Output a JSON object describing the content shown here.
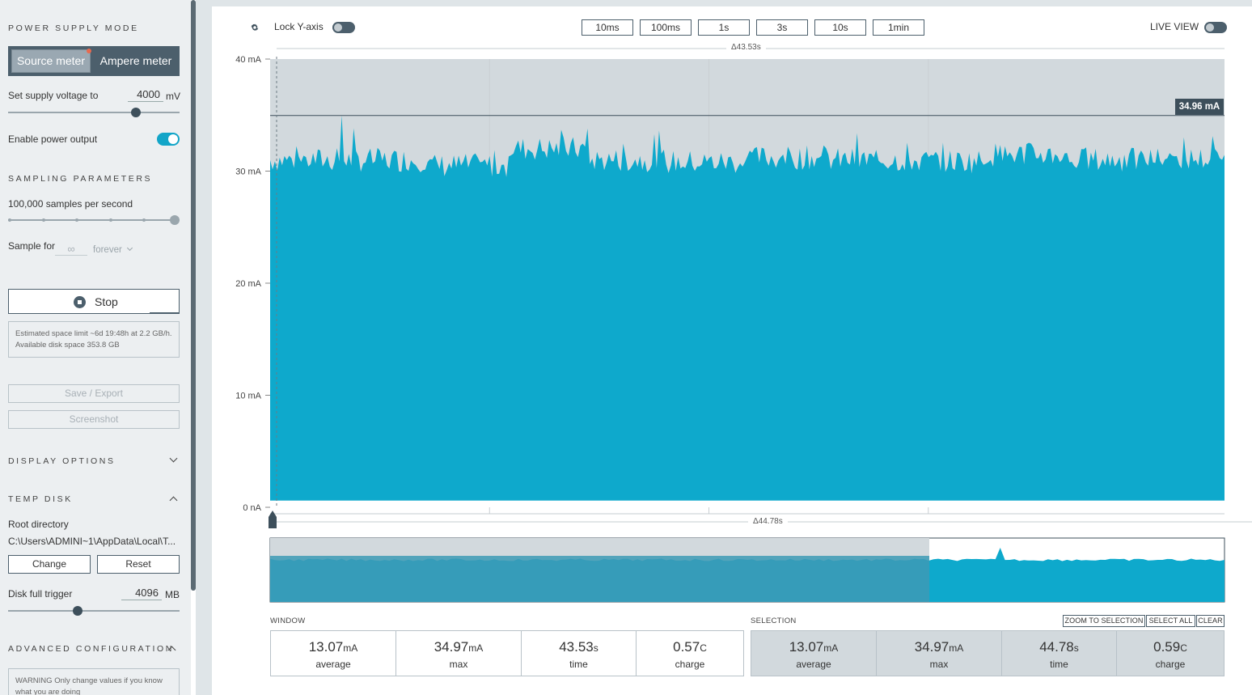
{
  "sidebar": {
    "power_supply_mode": {
      "title": "POWER SUPPLY MODE",
      "source_meter": "Source meter",
      "ampere_meter": "Ampere meter"
    },
    "supply_voltage": {
      "label": "Set supply voltage to",
      "value": "4000",
      "unit": "mV"
    },
    "enable_power_output": {
      "label": "Enable power output",
      "enabled": true
    },
    "sampling": {
      "title": "SAMPLING PARAMETERS",
      "rate_label": "100,000 samples per second",
      "sample_for_label": "Sample for",
      "sample_for_value": "∞",
      "sample_for_unit": "forever"
    },
    "stop_button": "Stop",
    "space_info": "Estimated space limit ~6d 19:48h at 2.2 GB/h. Available disk space 353.8 GB",
    "save_export": "Save / Export",
    "screenshot": "Screenshot",
    "display_options": {
      "title": "DISPLAY OPTIONS"
    },
    "temp_disk": {
      "title": "TEMP DISK",
      "root_directory_label": "Root directory",
      "root_directory_path": "C:\\Users\\ADMINI~1\\AppData\\Local\\T...",
      "change": "Change",
      "reset": "Reset",
      "disk_full_trigger_label": "Disk full trigger",
      "disk_full_trigger_value": "4096",
      "disk_full_trigger_unit": "MB"
    },
    "advanced_configuration": {
      "title": "ADVANCED CONFIGURATION",
      "warning": "WARNING Only change values if you know what you are doing"
    }
  },
  "toolbar": {
    "lock_y_axis": "Lock Y-axis",
    "window_buttons": [
      "10ms",
      "100ms",
      "1s",
      "3s",
      "10s",
      "1min"
    ],
    "live_view": "LIVE VIEW"
  },
  "chart": {
    "y_ticks": [
      "40 mA",
      "30 mA",
      "20 mA",
      "10 mA",
      "0 nA"
    ],
    "top_delta": "Δ43.53s",
    "bottom_delta": "Δ44.78s",
    "cursor_value": "34.96 mA",
    "colors": {
      "signal": "#0ea9cc",
      "selection_bg": "#d2d9dd",
      "grid": "#c9cfd3"
    }
  },
  "chart_data": {
    "type": "area",
    "ylabel": "",
    "ylim": [
      0,
      40
    ],
    "y_unit": "mA",
    "series": [
      {
        "values": [
          31,
          31,
          30.5,
          32,
          31,
          30.8,
          31.2,
          31,
          30.9,
          31.5,
          31,
          31.1
        ]
      }
    ],
    "peak": 34.97,
    "average": 13.07
  },
  "stats": {
    "window": {
      "title": "WINDOW",
      "items": [
        {
          "value": "13.07",
          "unit": "mA",
          "label": "average"
        },
        {
          "value": "34.97",
          "unit": "mA",
          "label": "max"
        },
        {
          "value": "43.53",
          "unit": "s",
          "label": "time"
        },
        {
          "value": "0.57",
          "unit": "C",
          "label": "charge"
        }
      ]
    },
    "selection": {
      "title": "SELECTION",
      "zoom_to_selection": "ZOOM TO SELECTION",
      "select_all": "SELECT ALL",
      "clear": "CLEAR",
      "items": [
        {
          "value": "13.07",
          "unit": "mA",
          "label": "average"
        },
        {
          "value": "34.97",
          "unit": "mA",
          "label": "max"
        },
        {
          "value": "44.78",
          "unit": "s",
          "label": "time"
        },
        {
          "value": "0.59",
          "unit": "C",
          "label": "charge"
        }
      ]
    }
  }
}
